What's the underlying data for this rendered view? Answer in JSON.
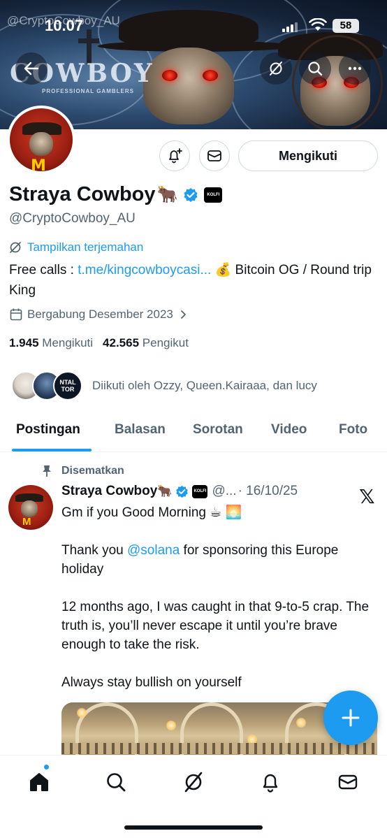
{
  "status_bar": {
    "watermark": "@CryptoCowboy_AU",
    "time": "10.07",
    "battery": "58"
  },
  "banner": {
    "logo_text": "COWBOY",
    "logo_subtitle": "PROFESSIONAL GAMBLERS"
  },
  "header": {
    "back_icon": "arrow-left-icon",
    "grok_icon": "grok-icon",
    "search_icon": "search-icon",
    "more_icon": "more-icon"
  },
  "profile": {
    "notify_icon": "bell-plus-icon",
    "message_icon": "mail-icon",
    "follow_label": "Mengikuti",
    "display_name": "Straya Cowboy",
    "name_emoji": "🐂",
    "affiliate_badge": "KOLFI",
    "handle": "@CryptoCowboy_AU",
    "translate_label": "Tampilkan terjemahan",
    "bio_prefix": "Free calls : ",
    "bio_link": "t.me/kingcowboycasi...",
    "bio_suffix": " 💰 Bitcoin OG / Round trip King",
    "joined": "Bergabung Desember 2023",
    "following_count": "1.945",
    "following_label": "Mengikuti",
    "followers_count": "42.565",
    "followers_label": "Pengikut",
    "followed_by": "Diikuti oleh Ozzy, Queen.Kairaaa, dan lucy",
    "followed_avatar_3_text": "NTAL TOR"
  },
  "tabs": [
    {
      "label": "Postingan",
      "active": true
    },
    {
      "label": "Balasan",
      "active": false
    },
    {
      "label": "Sorotan",
      "active": false
    },
    {
      "label": "Video",
      "active": false
    },
    {
      "label": "Foto",
      "active": false
    }
  ],
  "post": {
    "pinned_label": "Disematkan",
    "author": "Straya Cowboy",
    "author_emoji": "🐂",
    "affiliate_badge": "KOLFI",
    "handle_truncated": "@...",
    "date": "· 16/10/25",
    "x_logo": "𝕏",
    "line1": "Gm if you Good Morning ☕ 🌅",
    "para2_prefix": "Thank you ",
    "para2_mention": "@solana",
    "para2_suffix": " for sponsoring this Europe holiday",
    "para3": "12 months ago, I was caught in that 9-to-5 crap. The truth is, you’ll never escape it until you’re brave enough to take the risk.",
    "para4": "Always stay bullish on yourself"
  },
  "fab": {
    "icon": "plus-icon"
  },
  "bottom_nav": [
    {
      "icon": "home-icon",
      "active": true
    },
    {
      "icon": "search-icon",
      "active": false
    },
    {
      "icon": "grok-icon",
      "active": false
    },
    {
      "icon": "bell-icon",
      "active": false
    },
    {
      "icon": "mail-icon",
      "active": false
    }
  ],
  "colors": {
    "accent": "#1d9bf0",
    "text_primary": "#0f1419",
    "text_secondary": "#536471",
    "border": "#cfd9de"
  }
}
